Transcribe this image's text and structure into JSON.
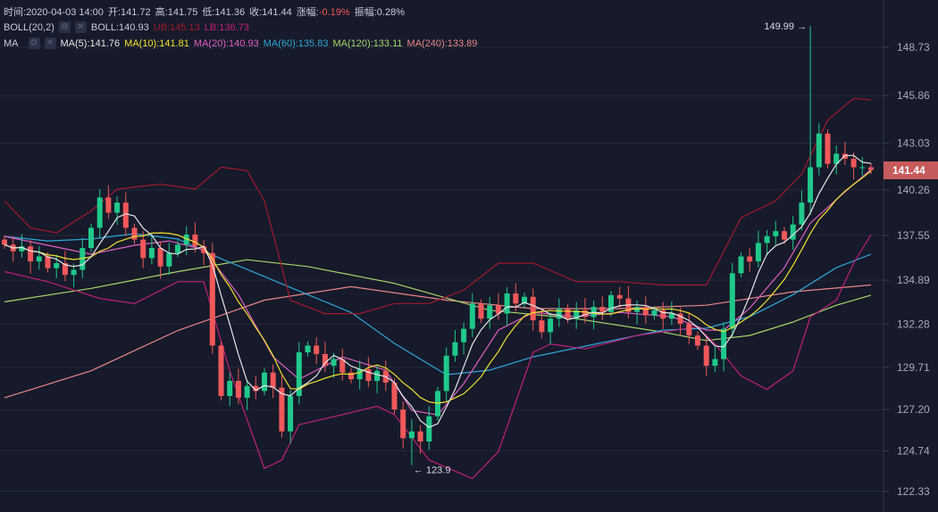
{
  "info": {
    "time_label": "时间:",
    "time": "2020-04-03 14:00",
    "open_label": "开:",
    "open": "141.72",
    "high_label": "高:",
    "high": "141.75",
    "low_label": "低:",
    "low": "141.36",
    "close_label": "收:",
    "close": "141.44",
    "change_label": "涨幅:",
    "change": "-0.19%",
    "amp_label": "振幅:",
    "amp": "0.28%"
  },
  "boll": {
    "name": "BOLL(20,2)",
    "mid": "BOLL:140.93",
    "ub": "UB:145.13",
    "lb": "LB:136.73"
  },
  "ma": {
    "name": "MA",
    "ma5": "MA(5):141.76",
    "ma10": "MA(10):141.81",
    "ma20": "MA(20):140.93",
    "ma60": "MA(60):135.83",
    "ma120": "MA(120):133.11",
    "ma240": "MA(240):133.89"
  },
  "icons": {
    "settings": "gear-icon",
    "close": "close-icon"
  },
  "last_price": "141.44",
  "colors": {
    "up": "#1fc98b",
    "down": "#f0585a",
    "ma5": "#e6e6e6",
    "ma10": "#f2e12e",
    "ma20": "#e05fc2",
    "ma60": "#2fa7d9",
    "ma120": "#a9d46a",
    "ma240": "#e8868a",
    "ub": "#a3182e",
    "lb": "#c21e7a",
    "bg": "#161a2a",
    "tag": "#c75a5a"
  },
  "chart_data": {
    "type": "candlestick",
    "title": "",
    "y_ticks": [
      "148.73",
      "145.86",
      "143.03",
      "140.26",
      "137.55",
      "134.89",
      "132.28",
      "129.71",
      "127.20",
      "124.74",
      "122.33"
    ],
    "ylim": [
      122.33,
      148.73
    ],
    "closes": [
      137.0,
      136.6,
      136.9,
      136.0,
      136.3,
      135.6,
      135.9,
      135.2,
      135.5,
      136.8,
      138.0,
      139.8,
      138.9,
      139.5,
      138.0,
      137.3,
      136.2,
      136.8,
      135.7,
      136.5,
      137.0,
      137.6,
      136.9,
      136.5,
      131.0,
      128.0,
      128.9,
      127.9,
      128.6,
      128.3,
      129.4,
      128.5,
      125.9,
      128.0,
      130.6,
      131.0,
      130.5,
      129.8,
      130.2,
      129.4,
      129.0,
      129.6,
      128.9,
      129.5,
      128.8,
      127.2,
      125.5,
      125.9,
      125.3,
      126.8,
      128.3,
      130.4,
      131.2,
      132.0,
      133.5,
      132.6,
      133.4,
      132.9,
      134.1,
      133.5,
      133.9,
      132.5,
      131.8,
      132.6,
      133.2,
      132.6,
      133.1,
      132.7,
      133.3,
      133.0,
      134.0,
      133.8,
      133.0,
      133.3,
      132.8,
      133.1,
      132.6,
      132.9,
      132.3,
      131.6,
      131.0,
      129.8,
      130.2,
      132.0,
      135.3,
      136.3,
      136.0,
      137.1,
      137.5,
      137.8,
      137.3,
      138.2,
      139.5,
      141.6,
      143.6,
      141.8,
      142.4,
      142.1,
      141.6,
      141.6,
      141.44
    ],
    "annotations": [
      {
        "text": "149.99 →",
        "index": 93,
        "value": 149.99,
        "type": "max"
      },
      {
        "text": "← 123.9",
        "index": 47,
        "value": 123.9,
        "type": "min"
      }
    ],
    "lines": {
      "ma60": [
        [
          0,
          137.49
        ],
        [
          5,
          137.22
        ],
        [
          10,
          137.33
        ],
        [
          15,
          137.65
        ],
        [
          20,
          137.33
        ],
        [
          25,
          136.16
        ],
        [
          30,
          135.1
        ],
        [
          35,
          134.03
        ],
        [
          40,
          132.97
        ],
        [
          45,
          131.13
        ],
        [
          51,
          129.27
        ],
        [
          56,
          129.54
        ],
        [
          61,
          130.33
        ],
        [
          66,
          130.86
        ],
        [
          71,
          131.39
        ],
        [
          76,
          131.92
        ],
        [
          81,
          132.03
        ],
        [
          86,
          132.72
        ],
        [
          91,
          134.03
        ],
        [
          96,
          135.63
        ],
        [
          100,
          136.43
        ]
      ],
      "ma120": [
        [
          0,
          133.6
        ],
        [
          10,
          134.4
        ],
        [
          20,
          135.4
        ],
        [
          28,
          136.1
        ],
        [
          35,
          135.7
        ],
        [
          45,
          134.7
        ],
        [
          56,
          133.1
        ],
        [
          66,
          132.6
        ],
        [
          76,
          131.8
        ],
        [
          81,
          131.3
        ],
        [
          86,
          131.6
        ],
        [
          91,
          132.4
        ],
        [
          96,
          133.4
        ],
        [
          100,
          134.0
        ]
      ],
      "ma240": [
        [
          0,
          127.9
        ],
        [
          10,
          129.5
        ],
        [
          20,
          131.9
        ],
        [
          30,
          133.7
        ],
        [
          40,
          134.5
        ],
        [
          51,
          133.7
        ],
        [
          61,
          133.2
        ],
        [
          71,
          133.2
        ],
        [
          81,
          133.4
        ],
        [
          91,
          134.2
        ],
        [
          100,
          134.6
        ]
      ],
      "ub": [
        [
          0,
          139.6
        ],
        [
          3,
          138.0
        ],
        [
          6,
          137.7
        ],
        [
          10,
          139.0
        ],
        [
          13,
          140.3
        ],
        [
          18,
          140.6
        ],
        [
          22,
          140.3
        ],
        [
          25,
          141.6
        ],
        [
          28,
          141.4
        ],
        [
          30,
          139.6
        ],
        [
          33,
          133.7
        ],
        [
          37,
          132.9
        ],
        [
          41,
          132.9
        ],
        [
          45,
          133.5
        ],
        [
          49,
          133.5
        ],
        [
          53,
          134.3
        ],
        [
          57,
          135.9
        ],
        [
          61,
          135.9
        ],
        [
          66,
          134.8
        ],
        [
          71,
          134.8
        ],
        [
          76,
          134.6
        ],
        [
          81,
          134.6
        ],
        [
          85,
          138.6
        ],
        [
          89,
          139.6
        ],
        [
          92,
          141.2
        ],
        [
          95,
          144.4
        ],
        [
          98,
          145.7
        ],
        [
          100,
          145.6
        ]
      ],
      "lb": [
        [
          0,
          135.4
        ],
        [
          5,
          134.8
        ],
        [
          8,
          134.3
        ],
        [
          11,
          133.8
        ],
        [
          15,
          133.5
        ],
        [
          20,
          134.8
        ],
        [
          23,
          134.8
        ],
        [
          26,
          129.5
        ],
        [
          30,
          123.7
        ],
        [
          32,
          124.2
        ],
        [
          34,
          126.3
        ],
        [
          39,
          126.9
        ],
        [
          43,
          127.4
        ],
        [
          45,
          126.9
        ],
        [
          49,
          124.2
        ],
        [
          54,
          123.1
        ],
        [
          57,
          124.7
        ],
        [
          61,
          130.6
        ],
        [
          63,
          131.1
        ],
        [
          67,
          130.8
        ],
        [
          73,
          131.6
        ],
        [
          80,
          132.1
        ],
        [
          82,
          131.1
        ],
        [
          85,
          129.2
        ],
        [
          88,
          128.4
        ],
        [
          91,
          129.5
        ],
        [
          93,
          132.7
        ],
        [
          96,
          133.7
        ],
        [
          98,
          135.9
        ],
        [
          100,
          137.6
        ]
      ],
      "ma20": [
        [
          0,
          137.49
        ],
        [
          10,
          136.43
        ],
        [
          15,
          136.96
        ],
        [
          19,
          137.22
        ],
        [
          23,
          136.69
        ],
        [
          27,
          134.03
        ],
        [
          31,
          130.33
        ],
        [
          34,
          129.0
        ],
        [
          39,
          130.33
        ],
        [
          44,
          129.54
        ],
        [
          47,
          127.15
        ],
        [
          50,
          126.88
        ],
        [
          53,
          128.74
        ],
        [
          57,
          131.92
        ],
        [
          61,
          132.97
        ],
        [
          66,
          132.72
        ],
        [
          71,
          132.97
        ],
        [
          77,
          132.72
        ],
        [
          81,
          131.92
        ],
        [
          83,
          131.92
        ],
        [
          86,
          133.23
        ],
        [
          90,
          135.63
        ],
        [
          93,
          138.28
        ],
        [
          97,
          140.14
        ],
        [
          100,
          141.46
        ]
      ]
    }
  }
}
